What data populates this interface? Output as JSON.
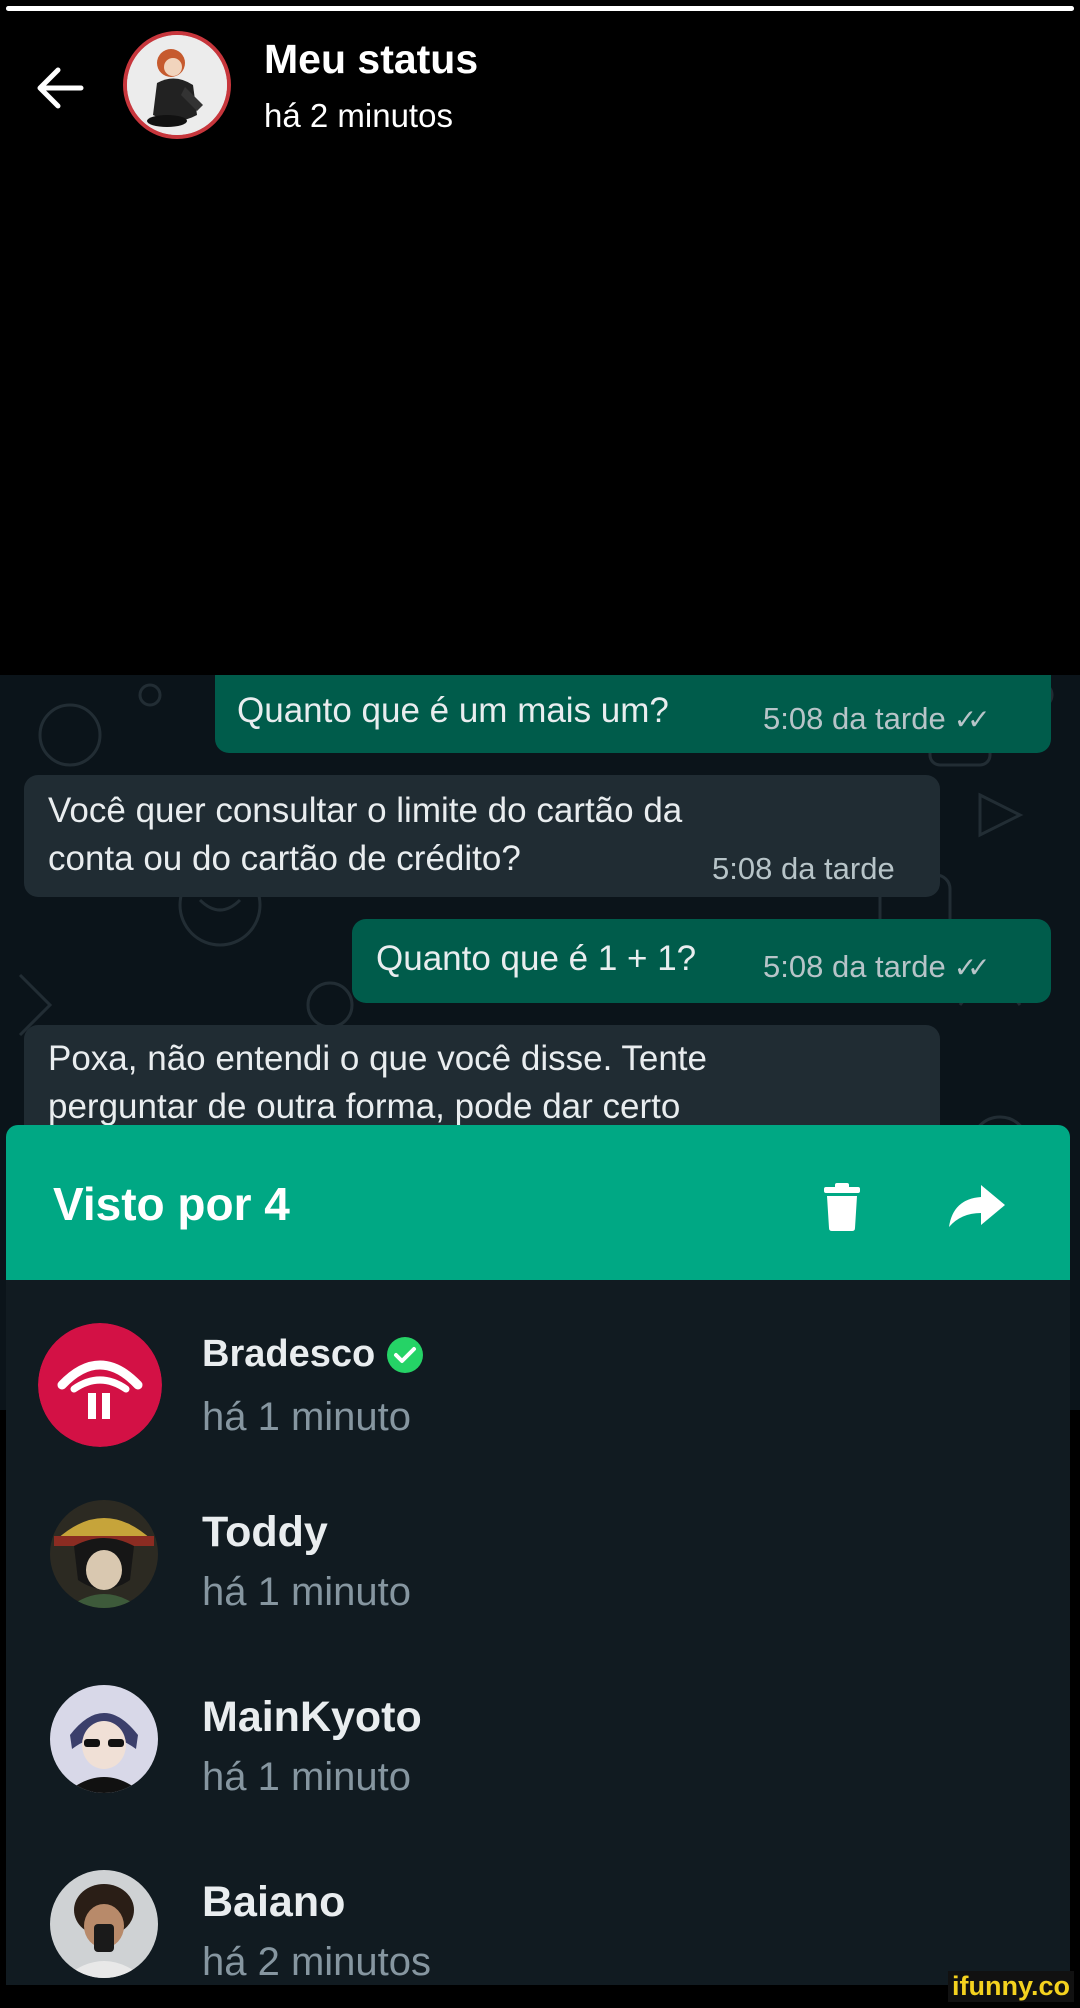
{
  "status_progress": 1.0,
  "header": {
    "title": "Meu status",
    "subtitle": "há 2 minutos"
  },
  "chat": {
    "messages": [
      {
        "direction": "out",
        "text": "Quanto que é um mais um?",
        "time": "5:08 da tarde",
        "ticks": "✓✓"
      },
      {
        "direction": "in",
        "line1": "Você quer consultar o limite do cartão da",
        "line2": "conta ou do cartão de crédito?",
        "time": "5:08 da tarde"
      },
      {
        "direction": "out",
        "text": "Quanto que é 1 + 1?",
        "time": "5:08 da tarde",
        "ticks": "✓✓"
      },
      {
        "direction": "in",
        "line1": "Poxa, não entendi o que você disse. Tente",
        "line2": "perguntar de outra forma, pode dar certo"
      }
    ]
  },
  "sheet": {
    "title": "Visto por 4",
    "delete_icon": "trash-icon",
    "forward_icon": "share-arrow-icon"
  },
  "viewers": [
    {
      "name": "Bradesco",
      "time": "há 1 minuto",
      "verified": true
    },
    {
      "name": "Toddy",
      "time": "há 1 minuto"
    },
    {
      "name": "MainKyoto",
      "time": "há 1 minuto"
    },
    {
      "name": "Baiano",
      "time": "há 2 minutos"
    }
  ],
  "watermark": "ifunny.co",
  "colors": {
    "accent": "#00a884",
    "sheet_bg": "#111b21",
    "outgoing_bubble": "#005c4b",
    "incoming_bubble": "#202c33",
    "verified": "#25d366"
  }
}
